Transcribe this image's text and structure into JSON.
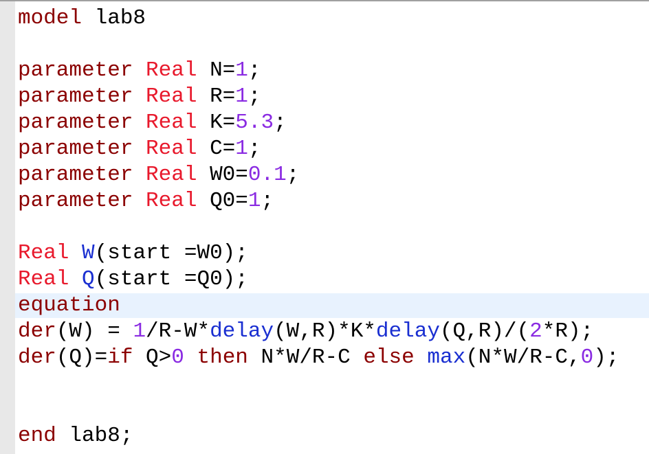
{
  "colors": {
    "keyword": "#8b0000",
    "type": "#e8192c",
    "number": "#8a2be2",
    "function": "#1a2fd1",
    "plain": "#000000",
    "current_line": "#e8f2fe",
    "gutter": "#e8e8e8"
  },
  "lines": [
    [
      {
        "t": "model",
        "c": "kw"
      },
      {
        "t": " lab8",
        "c": "plain"
      }
    ],
    [],
    [
      {
        "t": "parameter",
        "c": "kw"
      },
      {
        "t": " ",
        "c": "plain"
      },
      {
        "t": "Real",
        "c": "ty"
      },
      {
        "t": " N=",
        "c": "plain"
      },
      {
        "t": "1",
        "c": "num"
      },
      {
        "t": ";",
        "c": "plain"
      }
    ],
    [
      {
        "t": "parameter",
        "c": "kw"
      },
      {
        "t": " ",
        "c": "plain"
      },
      {
        "t": "Real",
        "c": "ty"
      },
      {
        "t": " R=",
        "c": "plain"
      },
      {
        "t": "1",
        "c": "num"
      },
      {
        "t": ";",
        "c": "plain"
      }
    ],
    [
      {
        "t": "parameter",
        "c": "kw"
      },
      {
        "t": " ",
        "c": "plain"
      },
      {
        "t": "Real",
        "c": "ty"
      },
      {
        "t": " K=",
        "c": "plain"
      },
      {
        "t": "5.3",
        "c": "num"
      },
      {
        "t": ";",
        "c": "plain"
      }
    ],
    [
      {
        "t": "parameter",
        "c": "kw"
      },
      {
        "t": " ",
        "c": "plain"
      },
      {
        "t": "Real",
        "c": "ty"
      },
      {
        "t": " C=",
        "c": "plain"
      },
      {
        "t": "1",
        "c": "num"
      },
      {
        "t": ";",
        "c": "plain"
      }
    ],
    [
      {
        "t": "parameter",
        "c": "kw"
      },
      {
        "t": " ",
        "c": "plain"
      },
      {
        "t": "Real",
        "c": "ty"
      },
      {
        "t": " W0=",
        "c": "plain"
      },
      {
        "t": "0.1",
        "c": "num"
      },
      {
        "t": ";",
        "c": "plain"
      }
    ],
    [
      {
        "t": "parameter",
        "c": "kw"
      },
      {
        "t": " ",
        "c": "plain"
      },
      {
        "t": "Real",
        "c": "ty"
      },
      {
        "t": " Q0=",
        "c": "plain"
      },
      {
        "t": "1",
        "c": "num"
      },
      {
        "t": ";",
        "c": "plain"
      }
    ],
    [],
    [
      {
        "t": "Real",
        "c": "ty"
      },
      {
        "t": " ",
        "c": "plain"
      },
      {
        "t": "W",
        "c": "fn"
      },
      {
        "t": "(start =W0);",
        "c": "plain"
      }
    ],
    [
      {
        "t": "Real",
        "c": "ty"
      },
      {
        "t": " ",
        "c": "plain"
      },
      {
        "t": "Q",
        "c": "fn"
      },
      {
        "t": "(start =Q0);",
        "c": "plain"
      }
    ],
    [
      {
        "t": "equation",
        "c": "kw"
      }
    ],
    [
      {
        "t": "der",
        "c": "kw"
      },
      {
        "t": "(W) = ",
        "c": "plain"
      },
      {
        "t": "1",
        "c": "num"
      },
      {
        "t": "/R-W*",
        "c": "plain"
      },
      {
        "t": "delay",
        "c": "fn"
      },
      {
        "t": "(W,R)*K*",
        "c": "plain"
      },
      {
        "t": "delay",
        "c": "fn"
      },
      {
        "t": "(Q,R)/(",
        "c": "plain"
      },
      {
        "t": "2",
        "c": "num"
      },
      {
        "t": "*R);",
        "c": "plain"
      }
    ],
    [
      {
        "t": "der",
        "c": "kw"
      },
      {
        "t": "(Q)=",
        "c": "plain"
      },
      {
        "t": "if",
        "c": "kw"
      },
      {
        "t": " Q>",
        "c": "plain"
      },
      {
        "t": "0",
        "c": "num"
      },
      {
        "t": " ",
        "c": "plain"
      },
      {
        "t": "then",
        "c": "kw"
      },
      {
        "t": " N*W/R-C ",
        "c": "plain"
      },
      {
        "t": "else",
        "c": "kw"
      },
      {
        "t": " ",
        "c": "plain"
      },
      {
        "t": "max",
        "c": "fn"
      },
      {
        "t": "(N*W/R-C,",
        "c": "plain"
      },
      {
        "t": "0",
        "c": "num"
      },
      {
        "t": ");",
        "c": "plain"
      }
    ],
    [],
    [],
    [
      {
        "t": "end",
        "c": "kw"
      },
      {
        "t": " lab8;",
        "c": "plain"
      }
    ]
  ],
  "current_line_index": 11
}
